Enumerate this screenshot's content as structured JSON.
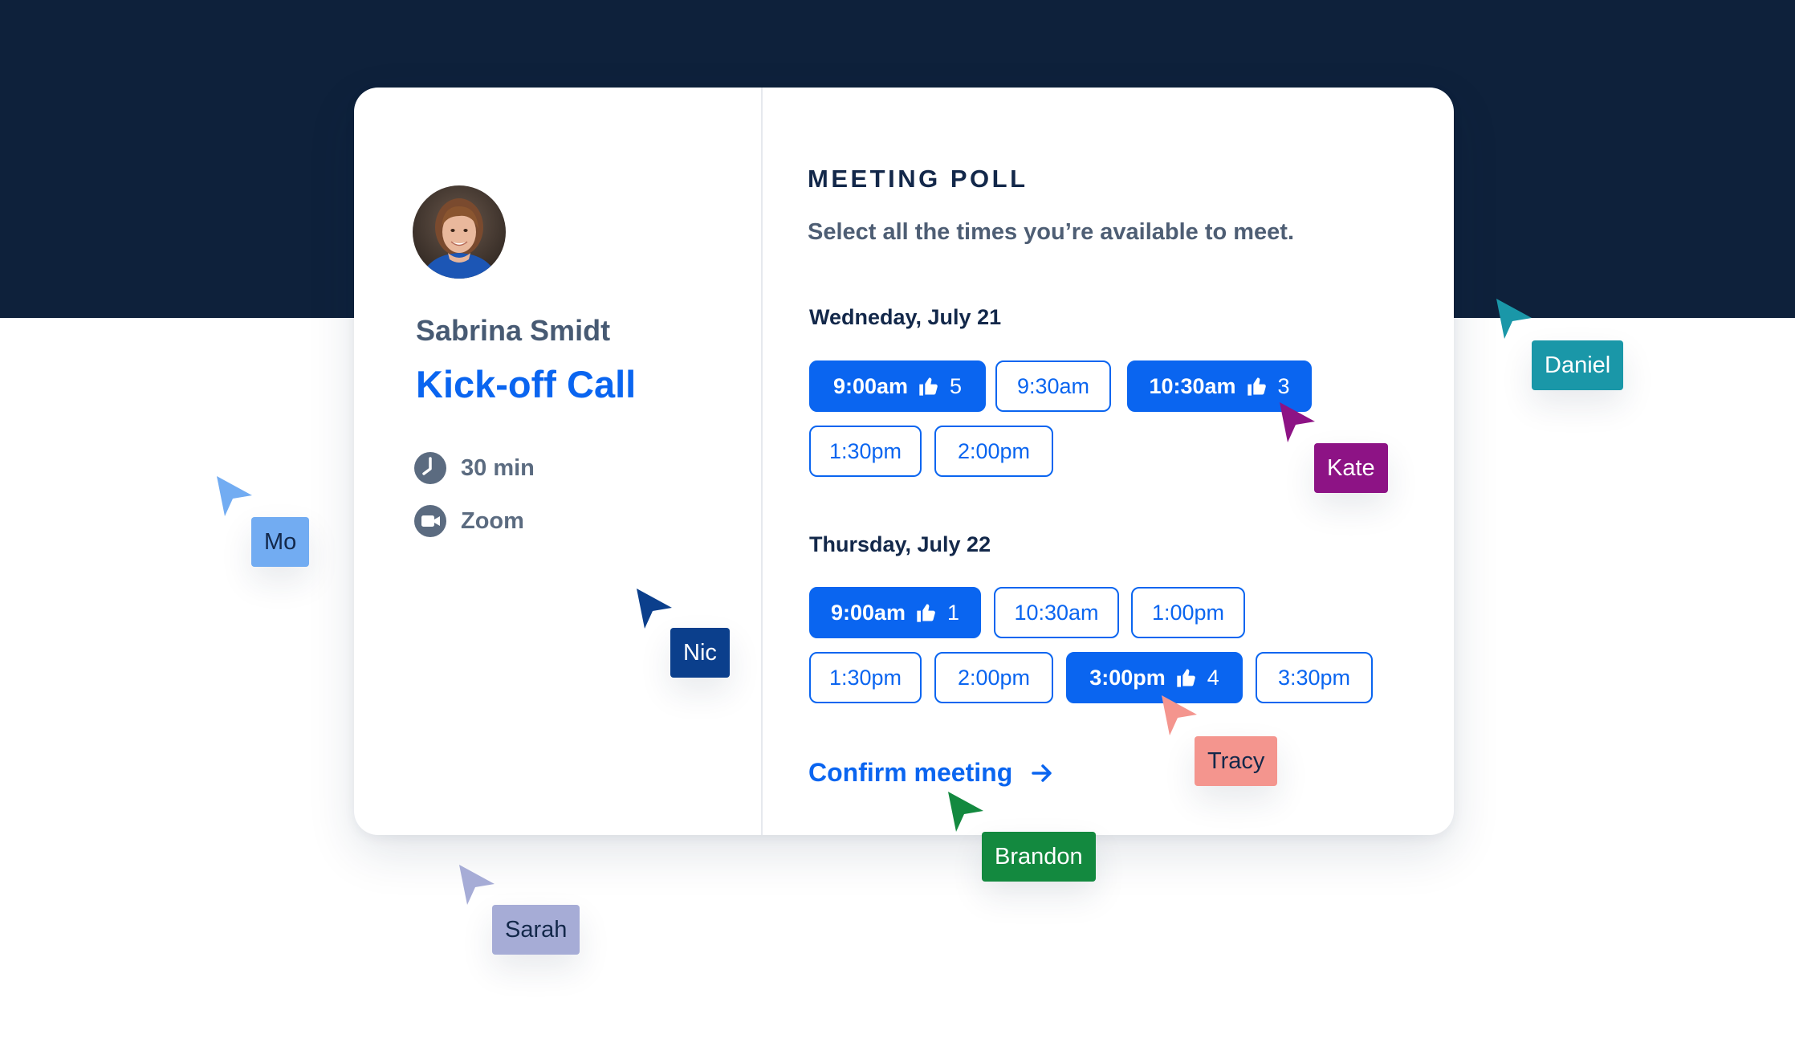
{
  "host": {
    "name": "Sabrina Smidt"
  },
  "event": {
    "title": "Kick-off Call",
    "duration": "30 min",
    "location": "Zoom"
  },
  "poll": {
    "title": "MEETING POLL",
    "subtitle": "Select all the times you’re available to meet.",
    "days": [
      {
        "label": "Wedneday, July 21",
        "slots": [
          {
            "time": "9:00am",
            "selected": true,
            "votes": "5"
          },
          {
            "time": "9:30am",
            "selected": false
          },
          {
            "time": "10:30am",
            "selected": true,
            "votes": "3"
          },
          {
            "time": "1:30pm",
            "selected": false
          },
          {
            "time": "2:00pm",
            "selected": false
          }
        ]
      },
      {
        "label": "Thursday, July 22",
        "slots": [
          {
            "time": "9:00am",
            "selected": true,
            "votes": "1"
          },
          {
            "time": "10:30am",
            "selected": false
          },
          {
            "time": "1:00pm",
            "selected": false
          },
          {
            "time": "1:30pm",
            "selected": false
          },
          {
            "time": "2:00pm",
            "selected": false
          },
          {
            "time": "3:00pm",
            "selected": true,
            "votes": "4"
          },
          {
            "time": "3:30pm",
            "selected": false
          }
        ]
      }
    ],
    "confirm_label": "Confirm meeting"
  },
  "icons": {
    "duration": "clock-icon",
    "location": "video-camera-icon",
    "vote": "thumbs-up-icon",
    "confirm": "arrow-right-icon",
    "cursor": "cursor-arrow-icon"
  },
  "colors": {
    "primary": "#0a65f0",
    "header_band": "#0e213b"
  },
  "cursors": [
    {
      "name": "Daniel",
      "color": "#1a97a8",
      "text_color": "#ffffff"
    },
    {
      "name": "Kate",
      "color": "#8d1385",
      "text_color": "#ffffff"
    },
    {
      "name": "Mo",
      "color": "#72acf2",
      "text_color": "#13284a"
    },
    {
      "name": "Nic",
      "color": "#0b3f8c",
      "text_color": "#ffffff"
    },
    {
      "name": "Tracy",
      "color": "#f4958e",
      "text_color": "#13284a"
    },
    {
      "name": "Brandon",
      "color": "#13893f",
      "text_color": "#ffffff"
    },
    {
      "name": "Sarah",
      "color": "#a6acd6",
      "text_color": "#13284a"
    }
  ]
}
